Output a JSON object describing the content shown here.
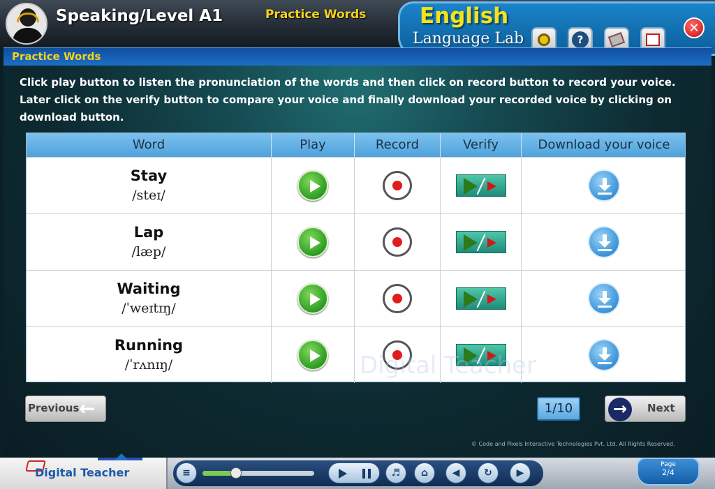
{
  "header": {
    "level_title": "Speaking/Level A1",
    "section_title": "Practice Words",
    "lab_title": "English",
    "lab_subtitle": "Language Lab",
    "toolbar_icons": [
      "settings-icon",
      "help-icon",
      "notes-icon",
      "window-icon"
    ],
    "help_glyph": "?",
    "close_glyph": "✕"
  },
  "section_bar": {
    "title": "Practice Words"
  },
  "instructions": "Click play button to listen the pronunciation of the words and then click on record button to record your voice. Later click on the verify button to compare your voice and finally download your recorded voice by clicking on download button.",
  "table": {
    "headers": [
      "Word",
      "Play",
      "Record",
      "Verify",
      "Download your voice"
    ],
    "rows": [
      {
        "word": "Stay",
        "phonetic": "/steɪ/"
      },
      {
        "word": "Lap",
        "phonetic": "/læp/"
      },
      {
        "word": "Waiting",
        "phonetic": "/ˈweɪtɪŋ/"
      },
      {
        "word": "Running",
        "phonetic": "/ˈrʌnɪŋ/"
      }
    ]
  },
  "navigation": {
    "previous_label": "Previous",
    "next_label": "Next",
    "page_counter": "1/10"
  },
  "watermark": "Digital Teacher",
  "copyright": "© Code and Pixels Interactive Technologies Pvt. Ltd. All Rights Reserved.",
  "footer": {
    "brand": "Digital Teacher",
    "progress": 0.3,
    "page_label": "Page",
    "page_value": "2/4"
  },
  "colors": {
    "accent_yellow": "#f4d21c",
    "header_blue": "#1a84c9",
    "play_green": "#2d9c22",
    "record_red": "#e21b1b",
    "download_blue": "#3b93d8"
  }
}
